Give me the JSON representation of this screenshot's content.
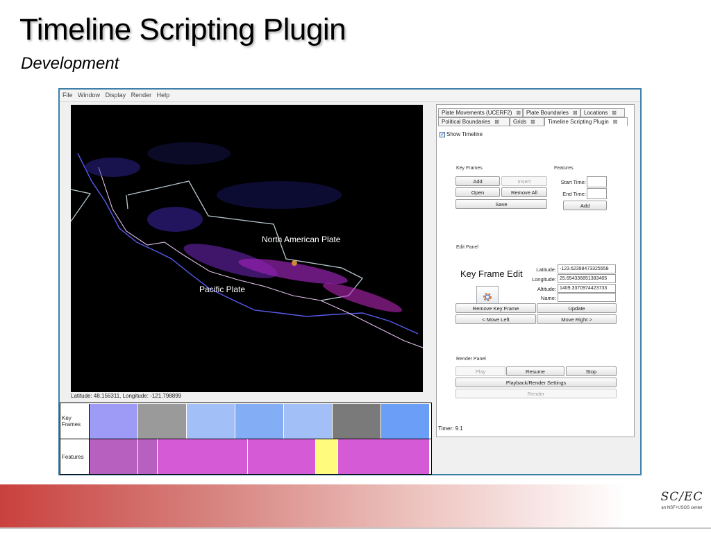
{
  "slide": {
    "title": "Timeline Scripting Plugin",
    "subtitle": "Development"
  },
  "menubar": [
    "File",
    "Window",
    "Display",
    "Render",
    "Help"
  ],
  "map": {
    "labels": [
      "North American Plate",
      "Pacific Plate"
    ],
    "coords_readout": "Latitude: 48.156311, Longitude: -121.798899"
  },
  "timeline": {
    "row_labels": [
      "Key Frames",
      "Features"
    ],
    "keyframe_colors": [
      "#9d9bf5",
      "#9a9a9a",
      "#a3bff7",
      "#83adf5",
      "#a3bff7",
      "#7a7a7a",
      "#6b9ff7"
    ],
    "feature_colors": [
      "#b860c0",
      "#b860c0",
      "#d55bd6",
      "#d55bd6",
      "#d55bd6",
      "#fffb7d",
      "#d55bd6"
    ]
  },
  "panel": {
    "tabs_row1": [
      "Plate Movements (UCERF2)",
      "Plate Boundaries",
      "Locations"
    ],
    "tabs_row2": [
      "Political Boundaries",
      "Grids",
      "Timeline Scripting Plugin"
    ],
    "tab_close": "⊠",
    "show_timeline": "Show Timeline",
    "show_timeline_check": "✓",
    "key_frames": {
      "label": "Key Frames",
      "add": "Add",
      "insert": "Insert",
      "open": "Open",
      "remove_all": "Remove All",
      "save": "Save"
    },
    "features": {
      "label": "Features",
      "start_time": "Start Time:",
      "end_time": "End Time:",
      "add": "Add"
    },
    "edit": {
      "label": "Edit Panel",
      "title": "Key Frame Edit",
      "latitude_label": "Latitude:",
      "latitude": "-123.62398473325558",
      "longitude_label": "Longitude:",
      "longitude": "25.654336851383405",
      "altitude_label": "Altitude:",
      "altitude": "1409.3370974423733",
      "name_label": "Name:",
      "name": "",
      "remove": "Remove Key Frame",
      "update": "Update",
      "move_left": "< Move Left",
      "move_right": "Move Right >"
    },
    "render": {
      "label": "Render Panel",
      "play": "Play",
      "resume": "Resume",
      "stop": "Stop",
      "settings": "Playback/Render Settings",
      "render": "Render"
    },
    "timer": "Timer: 9.1"
  },
  "footer": {
    "logo": "SC/EC",
    "logo_sub": "an NSF+USGS center"
  }
}
